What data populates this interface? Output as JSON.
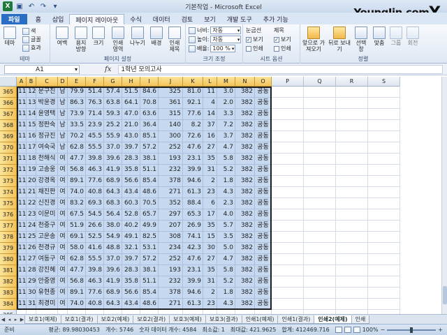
{
  "window": {
    "title": "기본작업 - Microsoft Excel",
    "logo": "YoungJin.com",
    "logo_mark": "Y."
  },
  "tabs": [
    "파일",
    "홈",
    "삽입",
    "페이지 레이아웃",
    "수식",
    "데이터",
    "검토",
    "보기",
    "개발 도구",
    "추가 기능"
  ],
  "active_tab": "페이지 레이아웃",
  "ribbon": {
    "theme": {
      "label": "테마",
      "btn": "테마",
      "colors": "색",
      "fonts": "글꼴",
      "effects": "효과"
    },
    "page_setup": {
      "label": "페이지 설정",
      "margins": "여백",
      "orientation": "용지 방향",
      "size": "크기",
      "print_area": "인쇄 영역",
      "breaks": "나누기",
      "background": "배경",
      "print_titles": "인쇄 제목"
    },
    "scale": {
      "label": "크기 조정",
      "width_label": "너비:",
      "width_value": "자동",
      "height_label": "높이:",
      "height_value": "자동",
      "scale_label": "배율:",
      "scale_value": "100 %"
    },
    "sheet_options": {
      "label": "시트 옵션",
      "gridlines": "눈금선",
      "headings": "제목",
      "view": "보기",
      "print": "인쇄"
    },
    "arrange": {
      "label": "정렬",
      "bring_forward": "앞으로 가져오기",
      "send_backward": "뒤로 보내기",
      "selection_pane": "선택 창",
      "align": "맞춤",
      "group": "그룹",
      "rotate": "회전"
    }
  },
  "formula_bar": {
    "name_box": "A1",
    "fx": "fx",
    "content": "1학년 모의고사"
  },
  "columns": [
    "A",
    "B",
    "C",
    "D",
    "E",
    "F",
    "G",
    "H",
    "I",
    "J",
    "K",
    "L",
    "M",
    "N",
    "O",
    "P",
    "Q",
    "R",
    "S"
  ],
  "rows": [
    {
      "n": "365",
      "c": [
        "11",
        "12",
        "문구진",
        "남",
        "79.9",
        "51.4",
        "57.4",
        "51.5",
        "84.6",
        "325",
        "81.0",
        "11",
        "3.0",
        "382",
        "공동"
      ]
    },
    {
      "n": "366",
      "c": [
        "11",
        "13",
        "박윤경",
        "남",
        "86.3",
        "76.3",
        "63.8",
        "64.1",
        "70.8",
        "361",
        "92.1",
        "4",
        "2.0",
        "382",
        "공동"
      ]
    },
    {
      "n": "367",
      "c": [
        "11",
        "14",
        "윤영택",
        "남",
        "73.9",
        "71.4",
        "59.3",
        "47.0",
        "63.6",
        "315",
        "77.6",
        "14",
        "3.3",
        "382",
        "공동"
      ]
    },
    {
      "n": "368",
      "c": [
        "11",
        "15",
        "정판숙",
        "남",
        "33.5",
        "23.9",
        "25.2",
        "21.0",
        "36.4",
        "140",
        "8.2",
        "37",
        "7.2",
        "382",
        "공동"
      ]
    },
    {
      "n": "369",
      "c": [
        "11",
        "16",
        "정규진",
        "남",
        "70.2",
        "45.5",
        "55.9",
        "43.0",
        "85.1",
        "300",
        "72.6",
        "16",
        "3.7",
        "382",
        "공동"
      ]
    },
    {
      "n": "370",
      "c": [
        "11",
        "17",
        "여숙국",
        "남",
        "62.8",
        "55.5",
        "37.0",
        "39.7",
        "57.2",
        "252",
        "47.6",
        "27",
        "4.7",
        "382",
        "공동"
      ]
    },
    {
      "n": "371",
      "c": [
        "11",
        "18",
        "천해식",
        "여",
        "47.7",
        "39.8",
        "39.6",
        "28.3",
        "38.1",
        "193",
        "23.1",
        "35",
        "5.8",
        "382",
        "공동"
      ]
    },
    {
      "n": "372",
      "c": [
        "11",
        "19",
        "고송웅",
        "여",
        "56.8",
        "46.3",
        "41.9",
        "35.8",
        "51.1",
        "232",
        "39.9",
        "31",
        "5.2",
        "382",
        "공동"
      ]
    },
    {
      "n": "373",
      "c": [
        "11",
        "20",
        "강경옥",
        "여",
        "89.1",
        "77.6",
        "68.9",
        "56.6",
        "85.4",
        "378",
        "94.6",
        "2",
        "1.8",
        "382",
        "공동"
      ]
    },
    {
      "n": "374",
      "c": [
        "11",
        "21",
        "채진판",
        "여",
        "74.0",
        "40.8",
        "64.3",
        "43.4",
        "48.6",
        "271",
        "61.3",
        "23",
        "4.3",
        "382",
        "공동"
      ]
    },
    {
      "n": "375",
      "c": [
        "11",
        "22",
        "신진경",
        "여",
        "83.2",
        "69.3",
        "68.3",
        "60.3",
        "70.5",
        "352",
        "88.4",
        "6",
        "2.3",
        "382",
        "공동"
      ]
    },
    {
      "n": "376",
      "c": [
        "11",
        "23",
        "이문미",
        "여",
        "67.5",
        "54.5",
        "56.4",
        "52.8",
        "65.7",
        "297",
        "65.3",
        "17",
        "4.0",
        "382",
        "공동"
      ]
    },
    {
      "n": "377",
      "c": [
        "11",
        "24",
        "천중구",
        "여",
        "51.9",
        "26.6",
        "38.0",
        "40.2",
        "49.9",
        "207",
        "26.9",
        "35",
        "5.7",
        "382",
        "공동"
      ]
    },
    {
      "n": "378",
      "c": [
        "11",
        "25",
        "고운송",
        "여",
        "69.1",
        "52.5",
        "54.9",
        "49.1",
        "82.5",
        "308",
        "74.1",
        "15",
        "3.5",
        "382",
        "공동"
      ]
    },
    {
      "n": "379",
      "c": [
        "11",
        "26",
        "천경규",
        "여",
        "58.0",
        "41.6",
        "48.8",
        "32.1",
        "53.1",
        "234",
        "42.3",
        "30",
        "5.0",
        "382",
        "공동"
      ]
    },
    {
      "n": "380",
      "c": [
        "11",
        "27",
        "여동구",
        "여",
        "62.8",
        "55.5",
        "37.0",
        "39.7",
        "57.2",
        "252",
        "47.6",
        "27",
        "4.7",
        "382",
        "공동"
      ]
    },
    {
      "n": "381",
      "c": [
        "11",
        "28",
        "강진혜",
        "여",
        "47.7",
        "39.8",
        "39.6",
        "28.3",
        "38.1",
        "193",
        "23.1",
        "35",
        "5.8",
        "382",
        "공동"
      ]
    },
    {
      "n": "382",
      "c": [
        "11",
        "29",
        "안중영",
        "여",
        "56.8",
        "46.3",
        "41.9",
        "35.8",
        "51.1",
        "232",
        "39.9",
        "31",
        "5.2",
        "382",
        "공동"
      ]
    },
    {
      "n": "383",
      "c": [
        "11",
        "30",
        "유현종",
        "여",
        "89.1",
        "77.6",
        "68.9",
        "56.6",
        "85.4",
        "378",
        "94.6",
        "2",
        "1.8",
        "382",
        "공동"
      ]
    },
    {
      "n": "384",
      "c": [
        "11",
        "31",
        "최경미",
        "여",
        "74.0",
        "40.8",
        "64.3",
        "43.4",
        "48.6",
        "271",
        "61.3",
        "23",
        "4.3",
        "382",
        "공동"
      ]
    },
    {
      "n": "385",
      "c": []
    },
    {
      "n": "386",
      "c": []
    }
  ],
  "sheets": [
    "보호1(예제)",
    "보호1(결과)",
    "보호2(예제)",
    "보호2(결과)",
    "보호3(예제)",
    "보호3(결과)",
    "인쇄1(예제)",
    "인쇄1(결과)",
    "인쇄2(예제)",
    "인쇄"
  ],
  "active_sheet": "인쇄2(예제)",
  "status": {
    "ready": "준비",
    "average": "평균: 89.98030453",
    "count": "개수: 5746",
    "numeric_count": "숫자 데이터 개수: 4584",
    "min": "최소값: 1",
    "max": "최대값: 421.9625",
    "sum": "합계: 412469.716",
    "zoom": "100%"
  }
}
